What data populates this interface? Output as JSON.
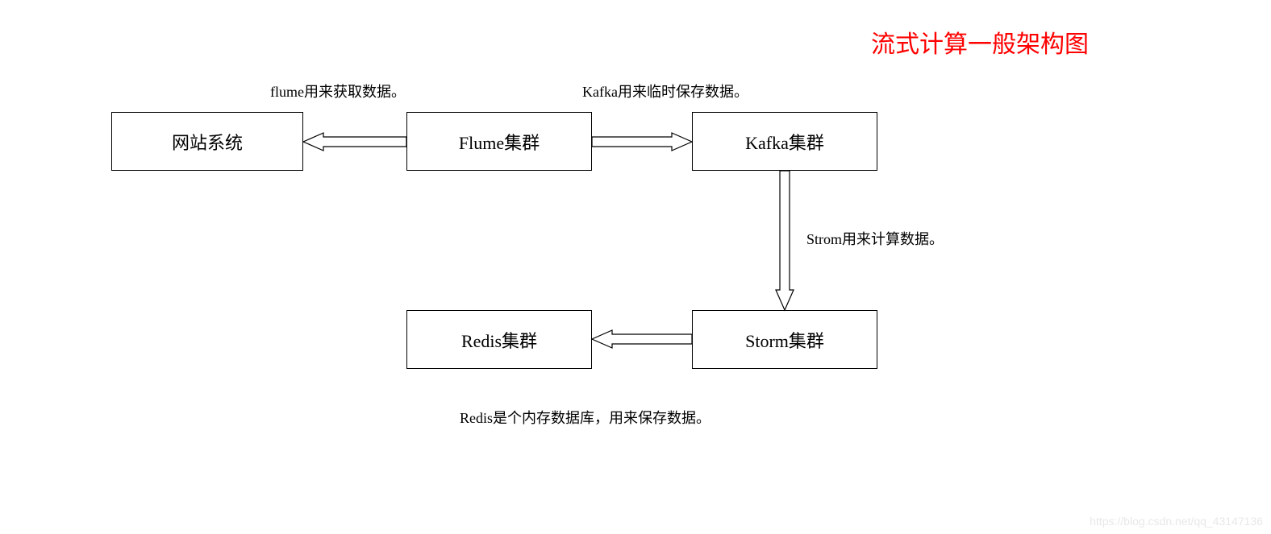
{
  "title": "流式计算一般架构图",
  "boxes": {
    "website": "网站系统",
    "flume": "Flume集群",
    "kafka": "Kafka集群",
    "storm": "Storm集群",
    "redis": "Redis集群"
  },
  "captions": {
    "flume_desc": "flume用来获取数据。",
    "kafka_desc": "Kafka用来临时保存数据。",
    "storm_desc": "Strom用来计算数据。",
    "redis_desc": "Redis是个内存数据库，用来保存数据。"
  },
  "watermark": "https://blog.csdn.net/qq_43147136",
  "chart_data": {
    "type": "flowchart",
    "title": "流式计算一般架构图",
    "nodes": [
      {
        "id": "website",
        "label": "网站系统"
      },
      {
        "id": "flume",
        "label": "Flume集群",
        "note": "flume用来获取数据。"
      },
      {
        "id": "kafka",
        "label": "Kafka集群",
        "note": "Kafka用来临时保存数据。"
      },
      {
        "id": "storm",
        "label": "Storm集群",
        "note": "Strom用来计算数据。"
      },
      {
        "id": "redis",
        "label": "Redis集群",
        "note": "Redis是个内存数据库，用来保存数据。"
      }
    ],
    "edges": [
      {
        "from": "flume",
        "to": "website",
        "direction": "left"
      },
      {
        "from": "flume",
        "to": "kafka",
        "direction": "right"
      },
      {
        "from": "kafka",
        "to": "storm",
        "direction": "down"
      },
      {
        "from": "storm",
        "to": "redis",
        "direction": "left"
      }
    ]
  }
}
